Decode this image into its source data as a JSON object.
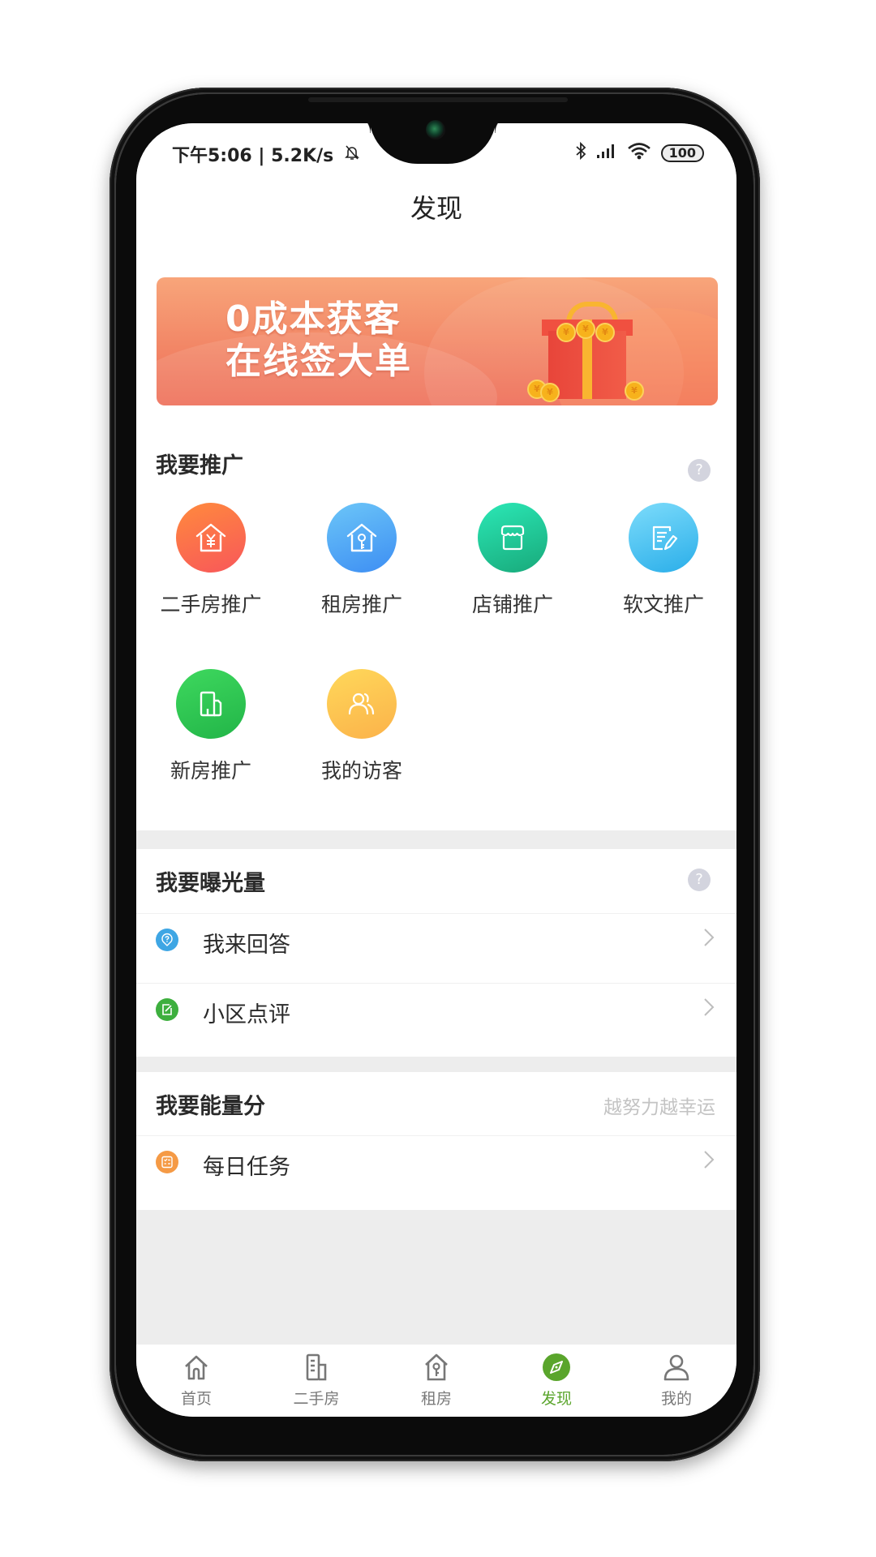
{
  "status_bar": {
    "time": "下午5:06",
    "net_speed": "5.2K/s",
    "battery": "100",
    "icons": [
      "bell-muted-icon",
      "bluetooth-icon",
      "signal-icon",
      "wifi-icon",
      "battery-icon"
    ]
  },
  "header": {
    "title": "发现"
  },
  "banner": {
    "line1": "0成本获客",
    "line2": "在线签大单"
  },
  "promote": {
    "title": "我要推广",
    "help_icon": "question-icon",
    "items": [
      {
        "label": "二手房推广",
        "icon": "house-yuan-icon",
        "color_from": "#ff8a3d",
        "color_to": "#f8575a"
      },
      {
        "label": "租房推广",
        "icon": "house-key-icon",
        "color_from": "#6cc6f8",
        "color_to": "#3d8ef3"
      },
      {
        "label": "店铺推广",
        "icon": "shop-icon",
        "color_from": "#2be8b6",
        "color_to": "#18a97a"
      },
      {
        "label": "软文推广",
        "icon": "article-edit-icon",
        "color_from": "#7ddcfb",
        "color_to": "#2aaee9"
      },
      {
        "label": "新房推广",
        "icon": "building-icon",
        "color_from": "#3ed85e",
        "color_to": "#22b548"
      },
      {
        "label": "我的访客",
        "icon": "visitors-icon",
        "color_from": "#ffd85a",
        "color_to": "#fbb24a"
      }
    ]
  },
  "exposure": {
    "title": "我要曝光量",
    "help_icon": "question-icon",
    "rows": [
      {
        "label": "我来回答",
        "icon": "answer-icon",
        "color": "#3ea6e4"
      },
      {
        "label": "小区点评",
        "icon": "review-edit-icon",
        "color": "#3daf3e"
      }
    ]
  },
  "energy": {
    "title": "我要能量分",
    "hint": "越努力越幸运",
    "rows": [
      {
        "label": "每日任务",
        "icon": "task-list-icon",
        "color": "#f59a45"
      }
    ]
  },
  "bottom_nav": {
    "active_color": "#5aa52c",
    "items": [
      {
        "label": "首页",
        "icon": "home-icon",
        "active": false
      },
      {
        "label": "二手房",
        "icon": "building-icon",
        "active": false
      },
      {
        "label": "租房",
        "icon": "house-key-icon",
        "active": false
      },
      {
        "label": "发现",
        "icon": "compass-icon",
        "active": true
      },
      {
        "label": "我的",
        "icon": "person-icon",
        "active": false
      }
    ]
  }
}
